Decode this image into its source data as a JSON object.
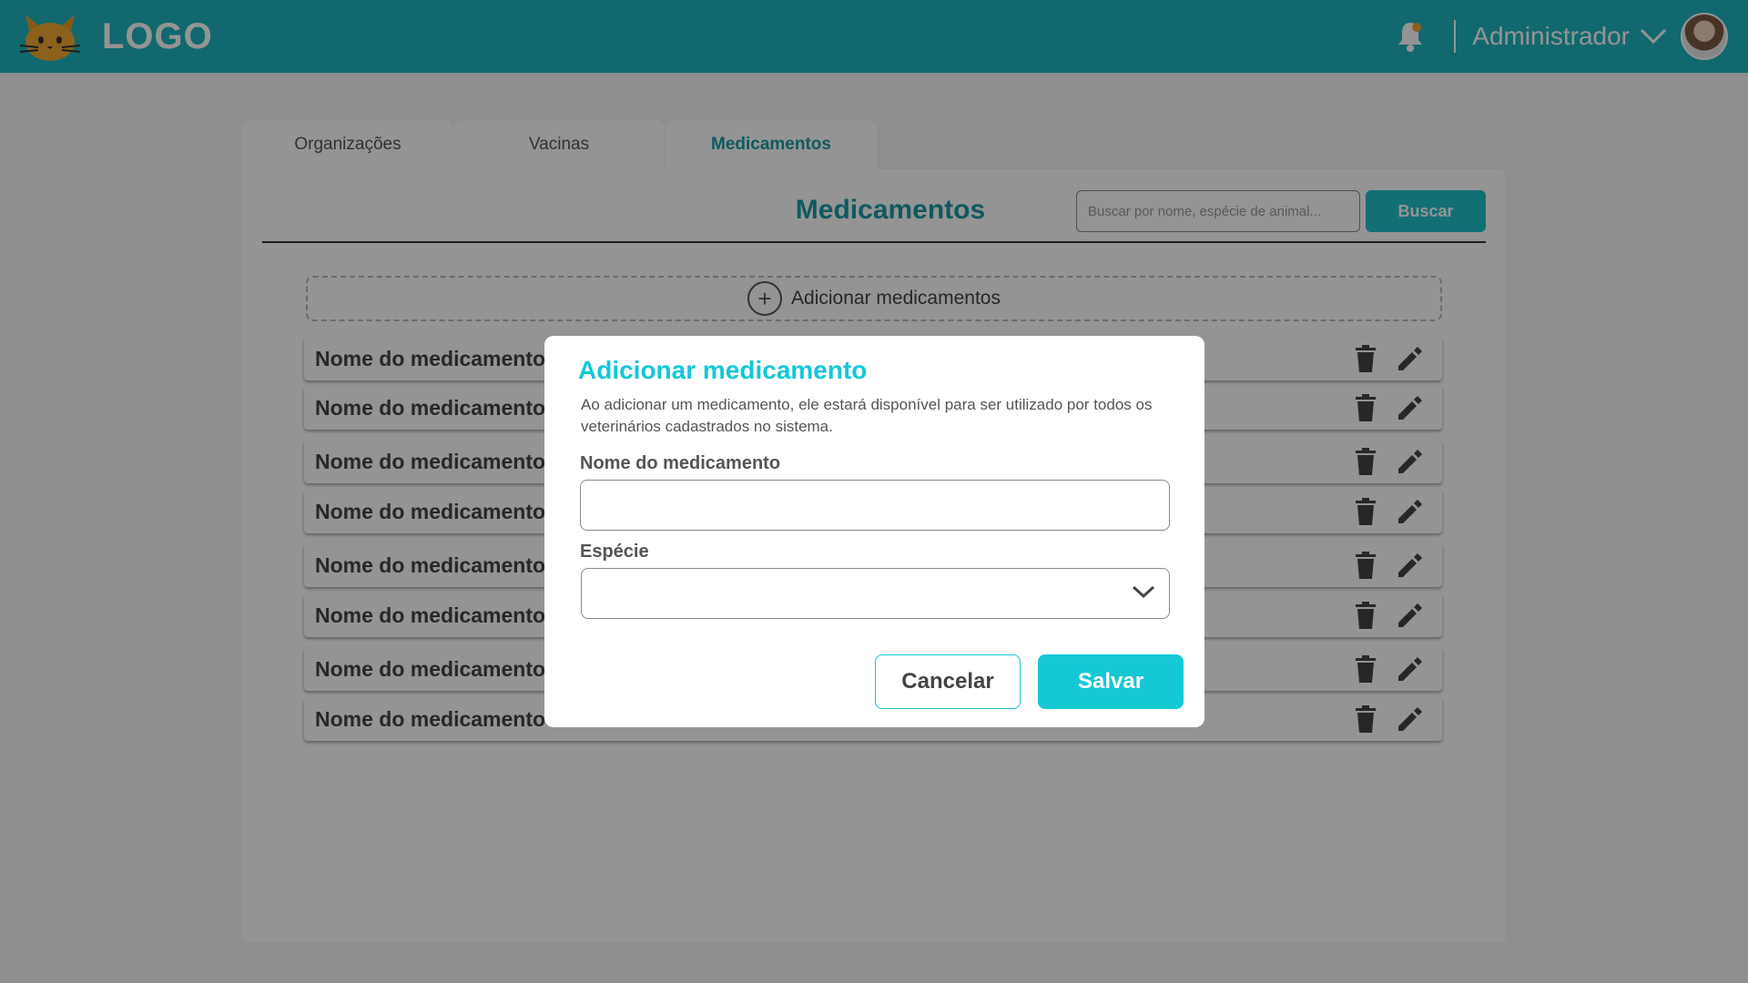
{
  "header": {
    "logo_text": "LOGO",
    "logo_icon": "cat-logo-icon",
    "notification_icon": "bell-icon",
    "user_name": "Administrador",
    "user_menu_icon": "chevron-down-icon",
    "brand_color": "#1eb4bd"
  },
  "tabs": [
    {
      "label": "Organizações",
      "active": false
    },
    {
      "label": "Vacinas",
      "active": false
    },
    {
      "label": "Medicamentos",
      "active": true
    }
  ],
  "main": {
    "title": "Medicamentos",
    "search": {
      "placeholder": "Buscar por nome, espécie de animal...",
      "value": ""
    },
    "search_button": "Buscar",
    "add_label": "Adicionar medicamentos",
    "rows": [
      {
        "name": "Nome do medicamento"
      },
      {
        "name": "Nome do medicamento"
      },
      {
        "name": "Nome do medicamento"
      },
      {
        "name": "Nome do medicamento"
      },
      {
        "name": "Nome do medicamento"
      },
      {
        "name": "Nome do medicamento"
      },
      {
        "name": "Nome do medicamento"
      },
      {
        "name": "Nome do medicamento"
      }
    ],
    "row_icons": [
      "trash-icon",
      "pencil-icon"
    ]
  },
  "modal": {
    "title": "Adicionar medicamento",
    "description": "Ao adicionar um medicamento, ele estará disponível para ser utilizado por todos os veterinários cadastrados no sistema.",
    "name_label": "Nome do medicamento",
    "name_value": "",
    "species_label": "Espécie",
    "species_value": "",
    "cancel_label": "Cancelar",
    "save_label": "Salvar",
    "accent_color": "#14c8d6"
  }
}
